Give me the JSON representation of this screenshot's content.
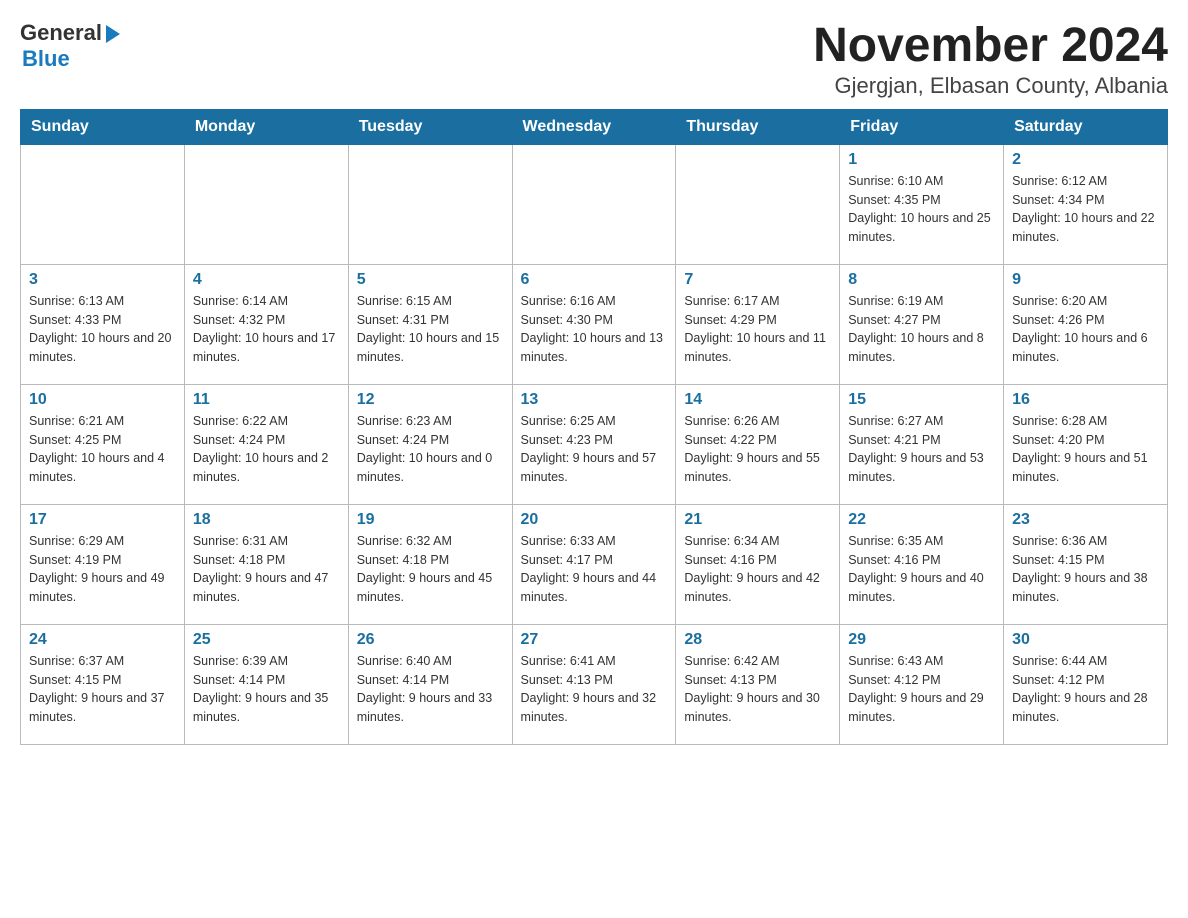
{
  "header": {
    "logo": {
      "general": "General",
      "triangle": "▶",
      "blue": "Blue"
    },
    "title": "November 2024",
    "subtitle": "Gjergjan, Elbasan County, Albania"
  },
  "weekdays": [
    "Sunday",
    "Monday",
    "Tuesday",
    "Wednesday",
    "Thursday",
    "Friday",
    "Saturday"
  ],
  "weeks": [
    [
      {
        "day": "",
        "sunrise": "",
        "sunset": "",
        "daylight": ""
      },
      {
        "day": "",
        "sunrise": "",
        "sunset": "",
        "daylight": ""
      },
      {
        "day": "",
        "sunrise": "",
        "sunset": "",
        "daylight": ""
      },
      {
        "day": "",
        "sunrise": "",
        "sunset": "",
        "daylight": ""
      },
      {
        "day": "",
        "sunrise": "",
        "sunset": "",
        "daylight": ""
      },
      {
        "day": "1",
        "sunrise": "Sunrise: 6:10 AM",
        "sunset": "Sunset: 4:35 PM",
        "daylight": "Daylight: 10 hours and 25 minutes."
      },
      {
        "day": "2",
        "sunrise": "Sunrise: 6:12 AM",
        "sunset": "Sunset: 4:34 PM",
        "daylight": "Daylight: 10 hours and 22 minutes."
      }
    ],
    [
      {
        "day": "3",
        "sunrise": "Sunrise: 6:13 AM",
        "sunset": "Sunset: 4:33 PM",
        "daylight": "Daylight: 10 hours and 20 minutes."
      },
      {
        "day": "4",
        "sunrise": "Sunrise: 6:14 AM",
        "sunset": "Sunset: 4:32 PM",
        "daylight": "Daylight: 10 hours and 17 minutes."
      },
      {
        "day": "5",
        "sunrise": "Sunrise: 6:15 AM",
        "sunset": "Sunset: 4:31 PM",
        "daylight": "Daylight: 10 hours and 15 minutes."
      },
      {
        "day": "6",
        "sunrise": "Sunrise: 6:16 AM",
        "sunset": "Sunset: 4:30 PM",
        "daylight": "Daylight: 10 hours and 13 minutes."
      },
      {
        "day": "7",
        "sunrise": "Sunrise: 6:17 AM",
        "sunset": "Sunset: 4:29 PM",
        "daylight": "Daylight: 10 hours and 11 minutes."
      },
      {
        "day": "8",
        "sunrise": "Sunrise: 6:19 AM",
        "sunset": "Sunset: 4:27 PM",
        "daylight": "Daylight: 10 hours and 8 minutes."
      },
      {
        "day": "9",
        "sunrise": "Sunrise: 6:20 AM",
        "sunset": "Sunset: 4:26 PM",
        "daylight": "Daylight: 10 hours and 6 minutes."
      }
    ],
    [
      {
        "day": "10",
        "sunrise": "Sunrise: 6:21 AM",
        "sunset": "Sunset: 4:25 PM",
        "daylight": "Daylight: 10 hours and 4 minutes."
      },
      {
        "day": "11",
        "sunrise": "Sunrise: 6:22 AM",
        "sunset": "Sunset: 4:24 PM",
        "daylight": "Daylight: 10 hours and 2 minutes."
      },
      {
        "day": "12",
        "sunrise": "Sunrise: 6:23 AM",
        "sunset": "Sunset: 4:24 PM",
        "daylight": "Daylight: 10 hours and 0 minutes."
      },
      {
        "day": "13",
        "sunrise": "Sunrise: 6:25 AM",
        "sunset": "Sunset: 4:23 PM",
        "daylight": "Daylight: 9 hours and 57 minutes."
      },
      {
        "day": "14",
        "sunrise": "Sunrise: 6:26 AM",
        "sunset": "Sunset: 4:22 PM",
        "daylight": "Daylight: 9 hours and 55 minutes."
      },
      {
        "day": "15",
        "sunrise": "Sunrise: 6:27 AM",
        "sunset": "Sunset: 4:21 PM",
        "daylight": "Daylight: 9 hours and 53 minutes."
      },
      {
        "day": "16",
        "sunrise": "Sunrise: 6:28 AM",
        "sunset": "Sunset: 4:20 PM",
        "daylight": "Daylight: 9 hours and 51 minutes."
      }
    ],
    [
      {
        "day": "17",
        "sunrise": "Sunrise: 6:29 AM",
        "sunset": "Sunset: 4:19 PM",
        "daylight": "Daylight: 9 hours and 49 minutes."
      },
      {
        "day": "18",
        "sunrise": "Sunrise: 6:31 AM",
        "sunset": "Sunset: 4:18 PM",
        "daylight": "Daylight: 9 hours and 47 minutes."
      },
      {
        "day": "19",
        "sunrise": "Sunrise: 6:32 AM",
        "sunset": "Sunset: 4:18 PM",
        "daylight": "Daylight: 9 hours and 45 minutes."
      },
      {
        "day": "20",
        "sunrise": "Sunrise: 6:33 AM",
        "sunset": "Sunset: 4:17 PM",
        "daylight": "Daylight: 9 hours and 44 minutes."
      },
      {
        "day": "21",
        "sunrise": "Sunrise: 6:34 AM",
        "sunset": "Sunset: 4:16 PM",
        "daylight": "Daylight: 9 hours and 42 minutes."
      },
      {
        "day": "22",
        "sunrise": "Sunrise: 6:35 AM",
        "sunset": "Sunset: 4:16 PM",
        "daylight": "Daylight: 9 hours and 40 minutes."
      },
      {
        "day": "23",
        "sunrise": "Sunrise: 6:36 AM",
        "sunset": "Sunset: 4:15 PM",
        "daylight": "Daylight: 9 hours and 38 minutes."
      }
    ],
    [
      {
        "day": "24",
        "sunrise": "Sunrise: 6:37 AM",
        "sunset": "Sunset: 4:15 PM",
        "daylight": "Daylight: 9 hours and 37 minutes."
      },
      {
        "day": "25",
        "sunrise": "Sunrise: 6:39 AM",
        "sunset": "Sunset: 4:14 PM",
        "daylight": "Daylight: 9 hours and 35 minutes."
      },
      {
        "day": "26",
        "sunrise": "Sunrise: 6:40 AM",
        "sunset": "Sunset: 4:14 PM",
        "daylight": "Daylight: 9 hours and 33 minutes."
      },
      {
        "day": "27",
        "sunrise": "Sunrise: 6:41 AM",
        "sunset": "Sunset: 4:13 PM",
        "daylight": "Daylight: 9 hours and 32 minutes."
      },
      {
        "day": "28",
        "sunrise": "Sunrise: 6:42 AM",
        "sunset": "Sunset: 4:13 PM",
        "daylight": "Daylight: 9 hours and 30 minutes."
      },
      {
        "day": "29",
        "sunrise": "Sunrise: 6:43 AM",
        "sunset": "Sunset: 4:12 PM",
        "daylight": "Daylight: 9 hours and 29 minutes."
      },
      {
        "day": "30",
        "sunrise": "Sunrise: 6:44 AM",
        "sunset": "Sunset: 4:12 PM",
        "daylight": "Daylight: 9 hours and 28 minutes."
      }
    ]
  ]
}
